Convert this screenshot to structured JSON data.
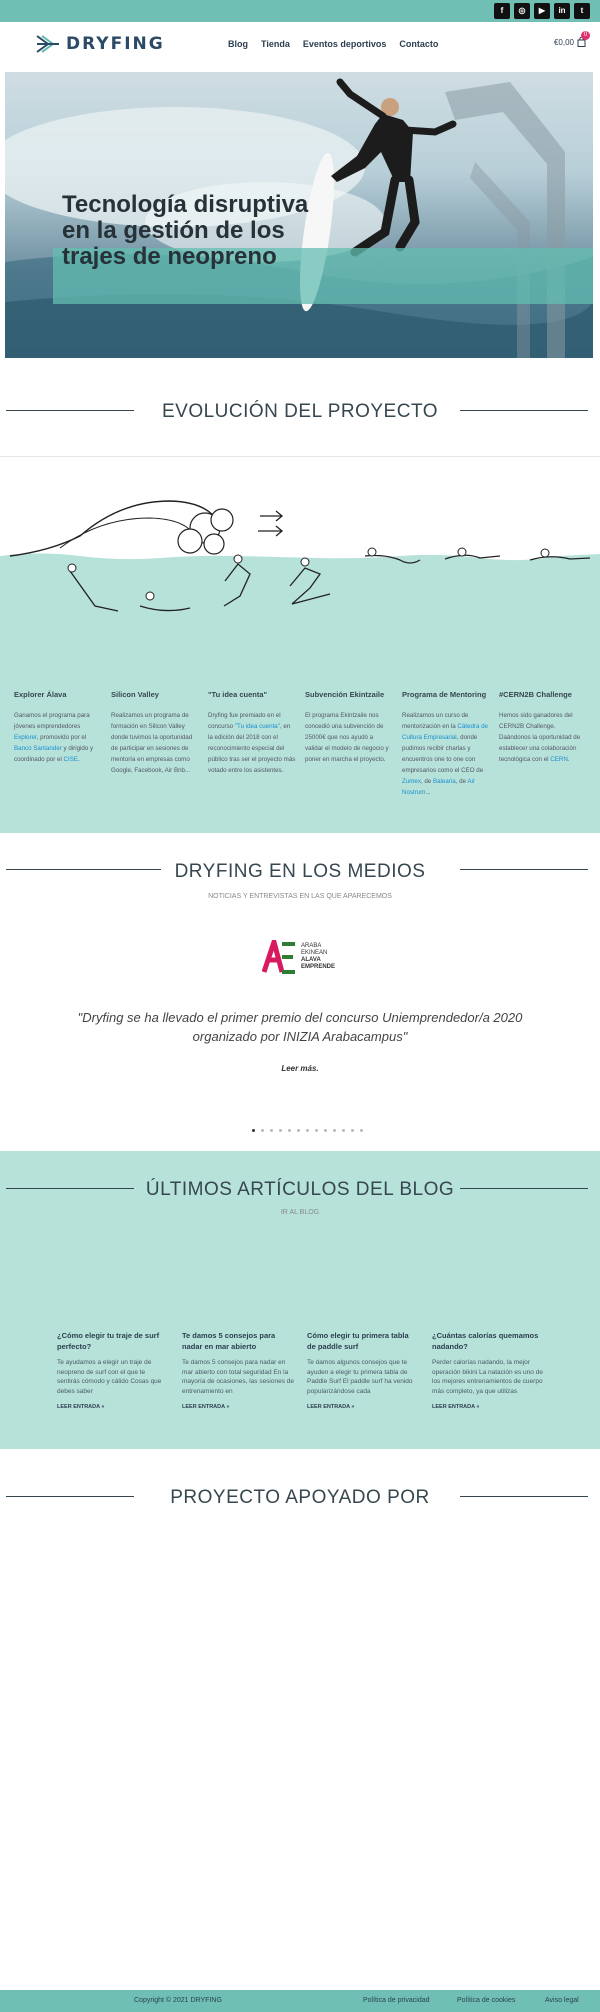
{
  "social": {
    "icons": [
      {
        "name": "facebook-icon",
        "glyph": "f"
      },
      {
        "name": "instagram-icon",
        "glyph": "◎"
      },
      {
        "name": "youtube-icon",
        "glyph": "▶"
      },
      {
        "name": "linkedin-icon",
        "glyph": "in"
      },
      {
        "name": "twitter-icon",
        "glyph": "t"
      }
    ]
  },
  "header": {
    "logo_text": "DRYFING",
    "nav": [
      "Blog",
      "Tienda",
      "Eventos deportivos",
      "Contacto"
    ],
    "cart_amount": "€0,00",
    "cart_count": "0"
  },
  "hero": {
    "title": "Tecnología disruptiva en la gestión de los trajes de neopreno"
  },
  "evolution": {
    "title": "EVOLUCIÓN DEL PROYECTO",
    "items": [
      {
        "heading": "Explorer Álava",
        "pre": "Ganamos el programa para jóvenes emprendedores ",
        "link1": "Explorer",
        "mid": ", promovido por el ",
        "link2": "Banco Santander",
        "post": " y dirigido y coordinado por el ",
        "link3": "CISE",
        "end": "."
      },
      {
        "heading": "Silicon Valley",
        "text": "Realizamos un programa de formación en Silicon Valley donde tuvimos la oportunidad de participar en sesiones de mentoría en empresas como Google, Facebook, Air Bnb..."
      },
      {
        "heading": "\"Tu idea cuenta\"",
        "pre": "Dryfing fue premiado en el concurso ",
        "link1": "\"Tu idea cuenta\"",
        "post": ", en la edición del 2018 con el reconocimiento especial del público tras ser el proyecto más votado entre los asistentes."
      },
      {
        "heading": "Subvención Ekintzaile",
        "text": "El programa Ekintzaile nos concedió una subvención de 25000€ que nos ayudó a validar el modelo de negocio y poner en marcha el proyecto."
      },
      {
        "heading": "Programa de Mentoring",
        "pre": "Realizamos un curso de mentorización en la ",
        "link1": "Cátedra de Cultura Empresarial",
        "mid": ", donde pudimos recibir charlas y encuentros one to one con empresarios como el CEO de ",
        "link2": "Zumex",
        "post": ", de ",
        "link3": "Balearia",
        "end": ", de ",
        "link4": "Air Nostrum",
        "tail": "..."
      },
      {
        "heading": "#CERN2B Challenge",
        "pre": "Hemos sido ganadores del CERN2B Challenge. Daándonos la oportunidad de establecer una colaboración tecnológica con el ",
        "link1": "CERN",
        "post": "."
      }
    ]
  },
  "media": {
    "title": "DRYFING EN LOS MEDIOS",
    "subtitle": "NOTICIAS Y ENTREVISTAS EN LAS QUE APARECEMOS",
    "logo_lines": [
      "ARABA",
      "EKINEAN",
      "ALAVA",
      "EMPRENDE"
    ],
    "quote": "\"Dryfing se ha llevado el primer premio del concurso Uniemprendedor/a 2020 organizado por INIZIA Arabacampus\"",
    "read_more": "Leer más.",
    "slide_count": 13,
    "active_slide": 1
  },
  "blog": {
    "title": "ÚLTIMOS ARTÍCULOS DEL BLOG",
    "subtitle": "IR AL BLOG",
    "posts": [
      {
        "title": "¿Cómo elegir tu traje de surf perfecto?",
        "excerpt": "Te ayudamos a elegir un traje de neopreno de surf con el que te sentirás cómodo y cálido Cosas que debes saber",
        "more": "LEER ENTRADA »"
      },
      {
        "title": "Te damos 5 consejos para nadar en mar abierto",
        "excerpt": "Te damos 5 consejos para nadar en mar abierto con total seguridad En la mayoría de ocasiones, las sesiones de entrenamiento en",
        "more": "LEER ENTRADA »"
      },
      {
        "title": "Cómo elegir tu primera tabla de paddle surf",
        "excerpt": "Te damos algunos consejos que te ayuden a elegir tu primera tabla de Paddle Surf El paddle surf ha venido popularizándose cada",
        "more": "LEER ENTRADA »"
      },
      {
        "title": "¿Cuántas calorías quemamos nadando?",
        "excerpt": "Perder calorías nadando, la mejor operación bikini La natación es uno de los mejores entrenamientos de cuerpo más completo, ya que utilizas",
        "more": "LEER ENTRADA »"
      }
    ]
  },
  "support": {
    "title": "PROYECTO APOYADO POR"
  },
  "footer": {
    "copyright": "Copyright © 2021 DRYFING",
    "links": [
      "Política de privacidad",
      "Política de cookies",
      "Aviso legal"
    ]
  },
  "colors": {
    "teal": "#6fbfb4",
    "mint": "#b7e2da",
    "dark": "#37474f",
    "link": "#1a8fcf",
    "accent": "#e0306e"
  }
}
